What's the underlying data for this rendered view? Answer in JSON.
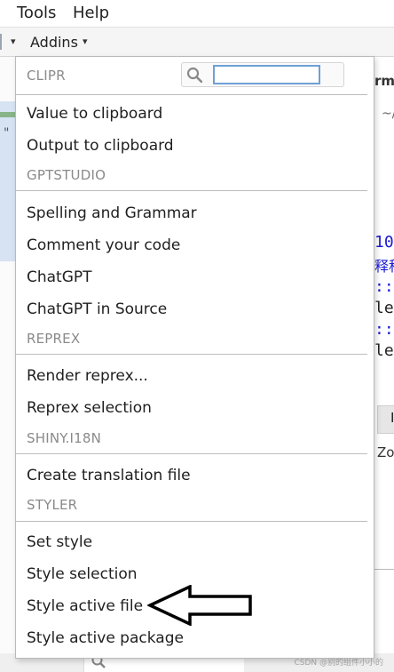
{
  "menubar": {
    "tools": "Tools",
    "help": "Help"
  },
  "toolbar": {
    "addins": "Addins",
    "addins_caret": "▾",
    "left_caret": "▾"
  },
  "background": {
    "left_quote": "\"",
    "right_title": "rmi",
    "right_tilde": "~/",
    "code_lines": [
      {
        "text": "10",
        "style": "blue"
      },
      {
        "text": "释科",
        "style": "blue"
      },
      {
        "text": "::",
        "style": "blue"
      },
      {
        "text": "le",
        "style": "dark"
      },
      {
        "text": "::",
        "style": "blue"
      },
      {
        "text": "le",
        "style": "dark"
      }
    ],
    "right_tab": "I",
    "right_zo": "Zo",
    "watermark": "CSDN @别的组件小小的"
  },
  "dropdown": {
    "filter": {
      "value": "",
      "placeholder": ""
    },
    "sections": [
      {
        "header": "CLIPR",
        "items": [
          "Value to clipboard",
          "Output to clipboard"
        ]
      },
      {
        "header": "GPTSTUDIO",
        "items": [
          "Spelling and Grammar",
          "Comment your code",
          "ChatGPT",
          "ChatGPT in Source"
        ]
      },
      {
        "header": "REPREX",
        "items": [
          "Render reprex...",
          "Reprex selection"
        ]
      },
      {
        "header": "SHINY.I18N",
        "items": [
          "Create translation file"
        ]
      },
      {
        "header": "STYLER",
        "items": [
          "Set style",
          "Style selection",
          "Style active file",
          "Style active package"
        ]
      }
    ]
  },
  "colors": {
    "menu_bg": "#ffffff",
    "header_text": "#8a8a8a",
    "divider": "#bdbdbd",
    "focus_border": "#6fa0d6",
    "code_blue": "#1b1bd6"
  },
  "icons": {
    "search": "search-icon",
    "arrow": "left-arrow-annotation-icon"
  }
}
